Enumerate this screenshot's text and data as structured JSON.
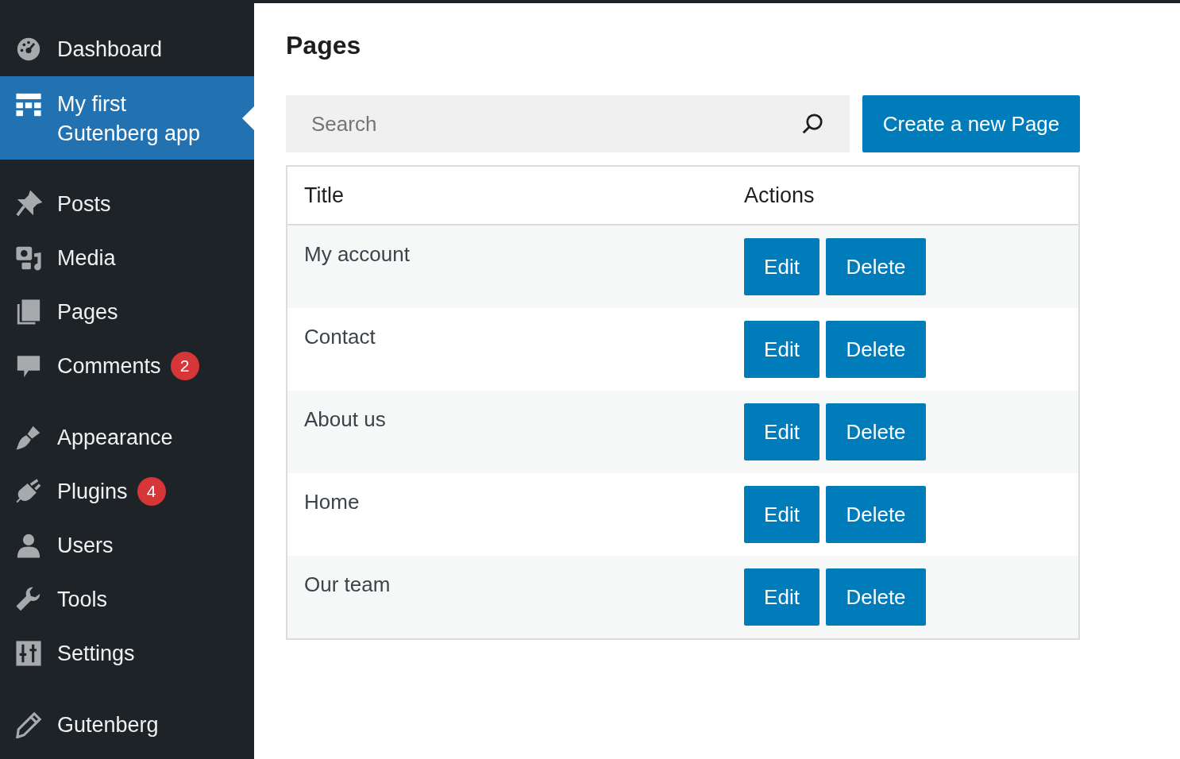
{
  "sidebar": {
    "groups": [
      {
        "items": [
          {
            "label": "Dashboard",
            "selected": false
          },
          {
            "label": "My first Gutenberg app",
            "selected": true
          }
        ]
      },
      {
        "items": [
          {
            "label": "Posts",
            "selected": false
          },
          {
            "label": "Media",
            "selected": false
          },
          {
            "label": "Pages",
            "selected": false
          },
          {
            "label": "Comments",
            "selected": false,
            "badge": "2"
          }
        ]
      },
      {
        "items": [
          {
            "label": "Appearance",
            "selected": false
          },
          {
            "label": "Plugins",
            "selected": false,
            "badge": "4"
          },
          {
            "label": "Users",
            "selected": false
          },
          {
            "label": "Tools",
            "selected": false
          },
          {
            "label": "Settings",
            "selected": false
          }
        ]
      },
      {
        "items": [
          {
            "label": "Gutenberg",
            "selected": false
          }
        ]
      }
    ]
  },
  "page": {
    "title": "Pages",
    "search": {
      "placeholder": "Search"
    },
    "create_button": "Create a new Page"
  },
  "table": {
    "columns": [
      "Title",
      "Actions"
    ],
    "rows": [
      {
        "title": "My account",
        "actions": [
          "Edit",
          "Delete"
        ]
      },
      {
        "title": "Contact",
        "actions": [
          "Edit",
          "Delete"
        ]
      },
      {
        "title": "About us",
        "actions": [
          "Edit",
          "Delete"
        ]
      },
      {
        "title": "Home",
        "actions": [
          "Edit",
          "Delete"
        ]
      },
      {
        "title": "Our team",
        "actions": [
          "Edit",
          "Delete"
        ]
      }
    ]
  }
}
